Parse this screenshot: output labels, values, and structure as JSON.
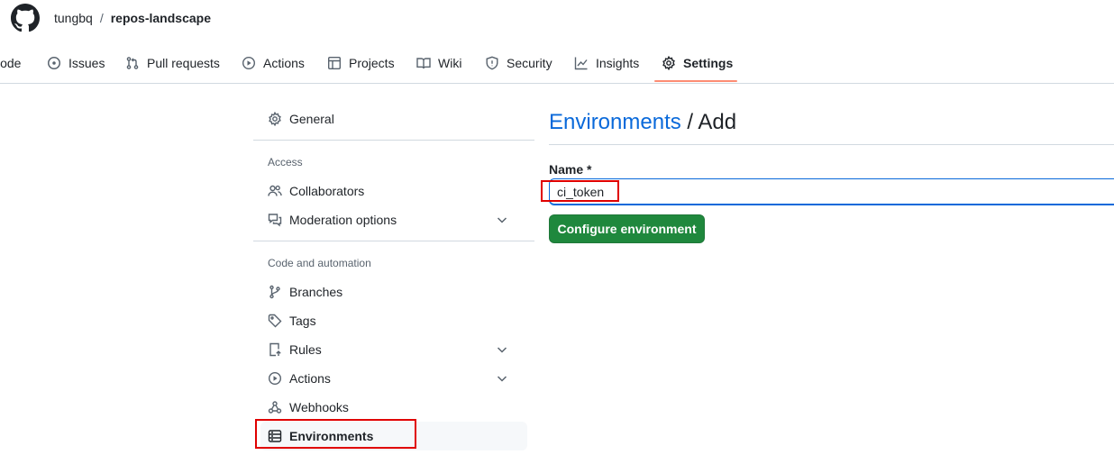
{
  "header": {
    "owner": "tungbq",
    "separator": "/",
    "repo": "repos-landscape"
  },
  "tabs": [
    {
      "label": "Code",
      "icon": "code-icon"
    },
    {
      "label": "Issues",
      "icon": "issue-opened-icon"
    },
    {
      "label": "Pull requests",
      "icon": "git-pull-request-icon"
    },
    {
      "label": "Actions",
      "icon": "play-icon"
    },
    {
      "label": "Projects",
      "icon": "table-icon"
    },
    {
      "label": "Wiki",
      "icon": "book-icon"
    },
    {
      "label": "Security",
      "icon": "shield-icon"
    },
    {
      "label": "Insights",
      "icon": "graph-icon"
    },
    {
      "label": "Settings",
      "icon": "gear-icon",
      "selected": true
    }
  ],
  "sidebar": {
    "general": "General",
    "access_heading": "Access",
    "collaborators": "Collaborators",
    "moderation": "Moderation options",
    "code_heading": "Code and automation",
    "branches": "Branches",
    "tags": "Tags",
    "rules": "Rules",
    "actions": "Actions",
    "webhooks": "Webhooks",
    "environments": "Environments"
  },
  "main": {
    "title_link": "Environments",
    "title_rest": " / Add",
    "name_label": "Name *",
    "name_value": "ci_token",
    "configure_button": "Configure environment"
  },
  "colors": {
    "accent_link": "#0969da",
    "primary_button": "#1f883d",
    "tab_underline": "#fd8c73",
    "highlight_box": "#e00000"
  }
}
